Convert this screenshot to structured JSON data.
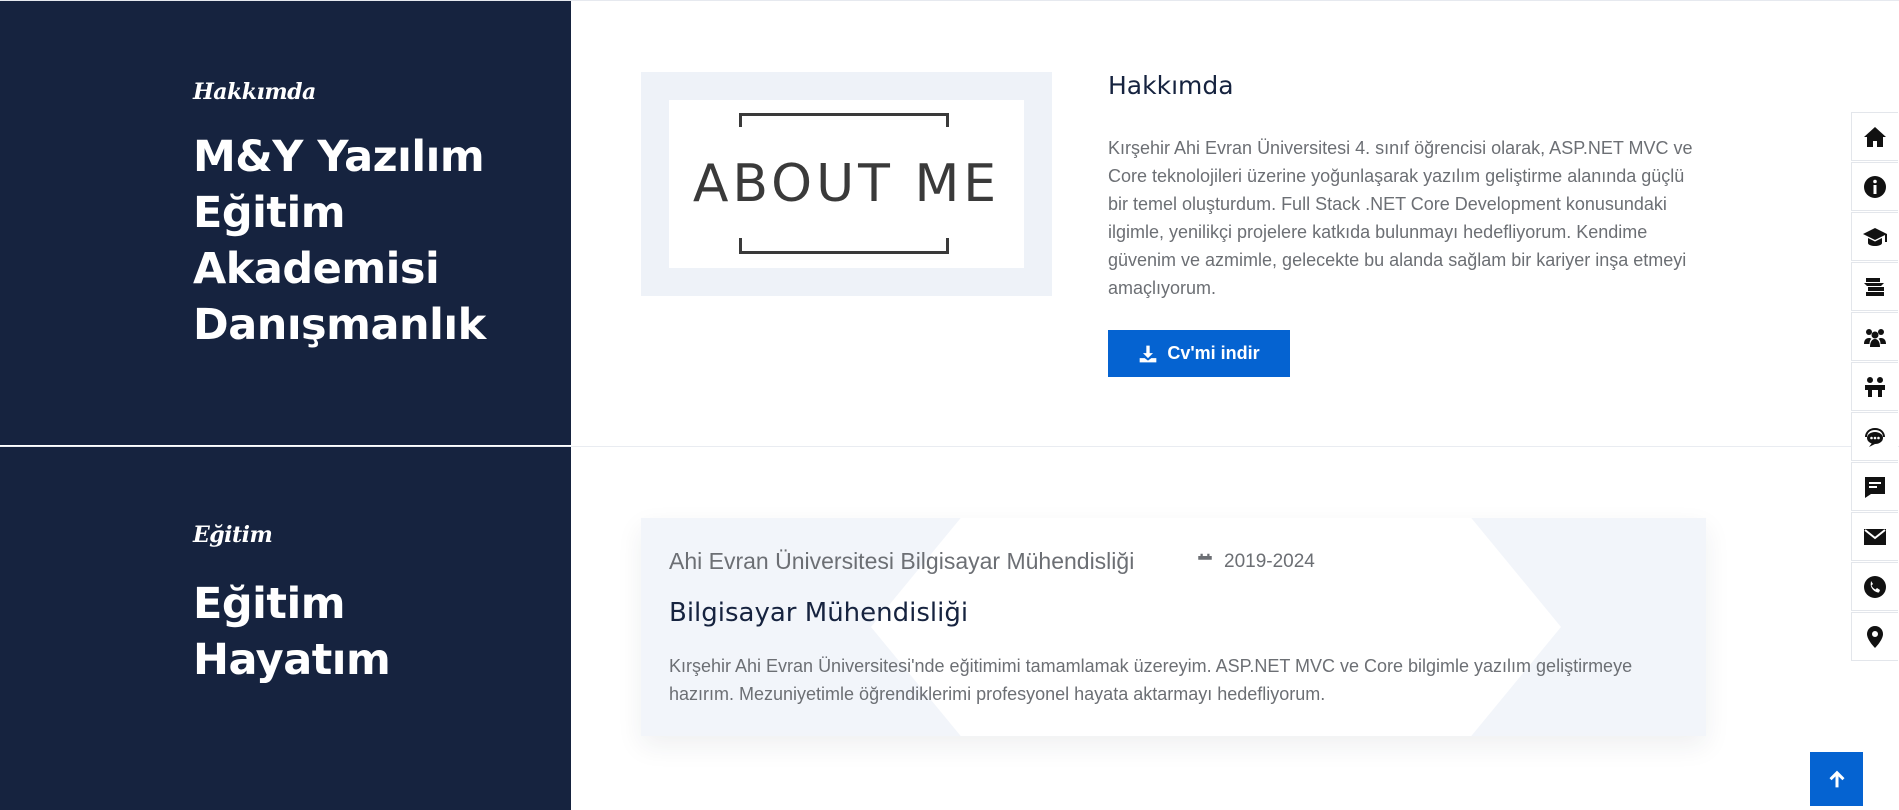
{
  "about": {
    "kicker": "Hakkımda",
    "title": "M&Y Yazılım Eğitim Akademisi Danışmanlık",
    "image_text": "ABOUT ME",
    "heading": "Hakkımda",
    "description": "Kırşehir Ahi Evran Üniversitesi 4. sınıf öğrencisi olarak, ASP.NET MVC ve Core teknolojileri üzerine yoğunlaşarak yazılım geliştirme alanında güçlü bir temel oluşturdum. Full Stack .NET Core Development konusundaki ilgimle, yenilikçi projelere katkıda bulunmayı hedefliyorum. Kendime güvenim ve azmimle, gelecekte bu alanda sağlam bir kariyer inşa etmeyi amaçlıyorum.",
    "cv_button": "Cv'mi indir"
  },
  "education": {
    "kicker": "Eğitim",
    "title": "Eğitim Hayatım",
    "school": "Ahi Evran Üniversitesi Bilgisayar Mühendisliği",
    "years": "2019-2024",
    "degree": "Bilgisayar Mühendisliği",
    "description": "Kırşehir Ahi Evran Üniversitesi'nde eğitimimi tamamlamak üzereyim. ASP.NET MVC ve Core bilgimle yazılım geliştirmeye hazırım. Mezuniyetimle öğrendiklerimi profesyonel hayata aktarmayı hedefliyorum."
  },
  "side_nav": [
    "home-icon",
    "info-icon",
    "graduation-cap-icon",
    "certificate-icon",
    "people-icon",
    "team-icon",
    "support-icon",
    "blog-icon",
    "mail-icon",
    "phone-icon",
    "location-icon"
  ],
  "colors": {
    "navy": "#16233f",
    "accent": "#0563d1"
  }
}
